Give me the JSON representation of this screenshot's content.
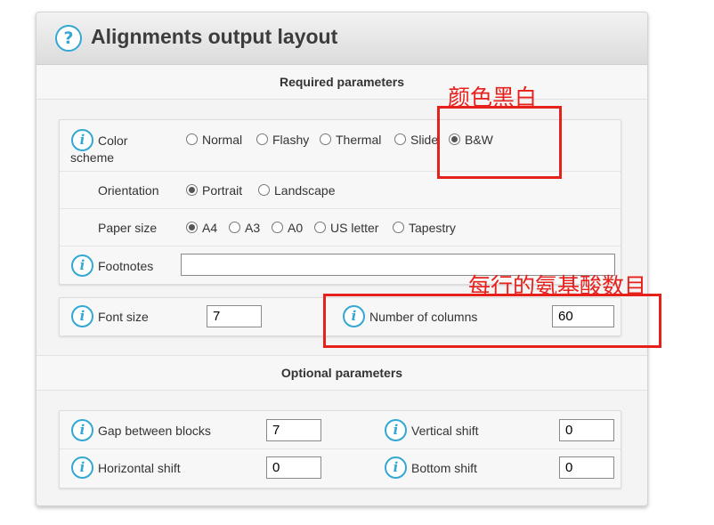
{
  "header": {
    "help_glyph": "?",
    "title": "Alignments output layout"
  },
  "required": {
    "heading": "Required parameters",
    "color_scheme": {
      "label_line1": "Color",
      "label_line2": "scheme",
      "options": [
        "Normal",
        "Flashy",
        "Thermal",
        "Slide",
        "B&W"
      ],
      "selected": "B&W"
    },
    "orientation": {
      "label": "Orientation",
      "options": [
        "Portrait",
        "Landscape"
      ],
      "selected": "Portrait"
    },
    "paper_size": {
      "label": "Paper size",
      "options": [
        "A4",
        "A3",
        "A0",
        "US letter",
        "Tapestry"
      ],
      "selected": "A4"
    },
    "footnotes": {
      "label": "Footnotes",
      "value": ""
    },
    "font_size": {
      "label": "Font size",
      "value": "7"
    },
    "columns": {
      "label": "Number of columns",
      "value": "60"
    }
  },
  "optional": {
    "heading": "Optional parameters",
    "gap": {
      "label": "Gap between blocks",
      "value": "7"
    },
    "vertical": {
      "label": "Vertical shift",
      "value": "0"
    },
    "horizontal": {
      "label": "Horizontal shift",
      "value": "0"
    },
    "bottom": {
      "label": "Bottom shift",
      "value": "0"
    }
  },
  "info_glyph": "i",
  "annotations": {
    "bw_note": "颜色黑白",
    "columns_note": "每行的氨基酸数目",
    "color": "#e8201c"
  }
}
